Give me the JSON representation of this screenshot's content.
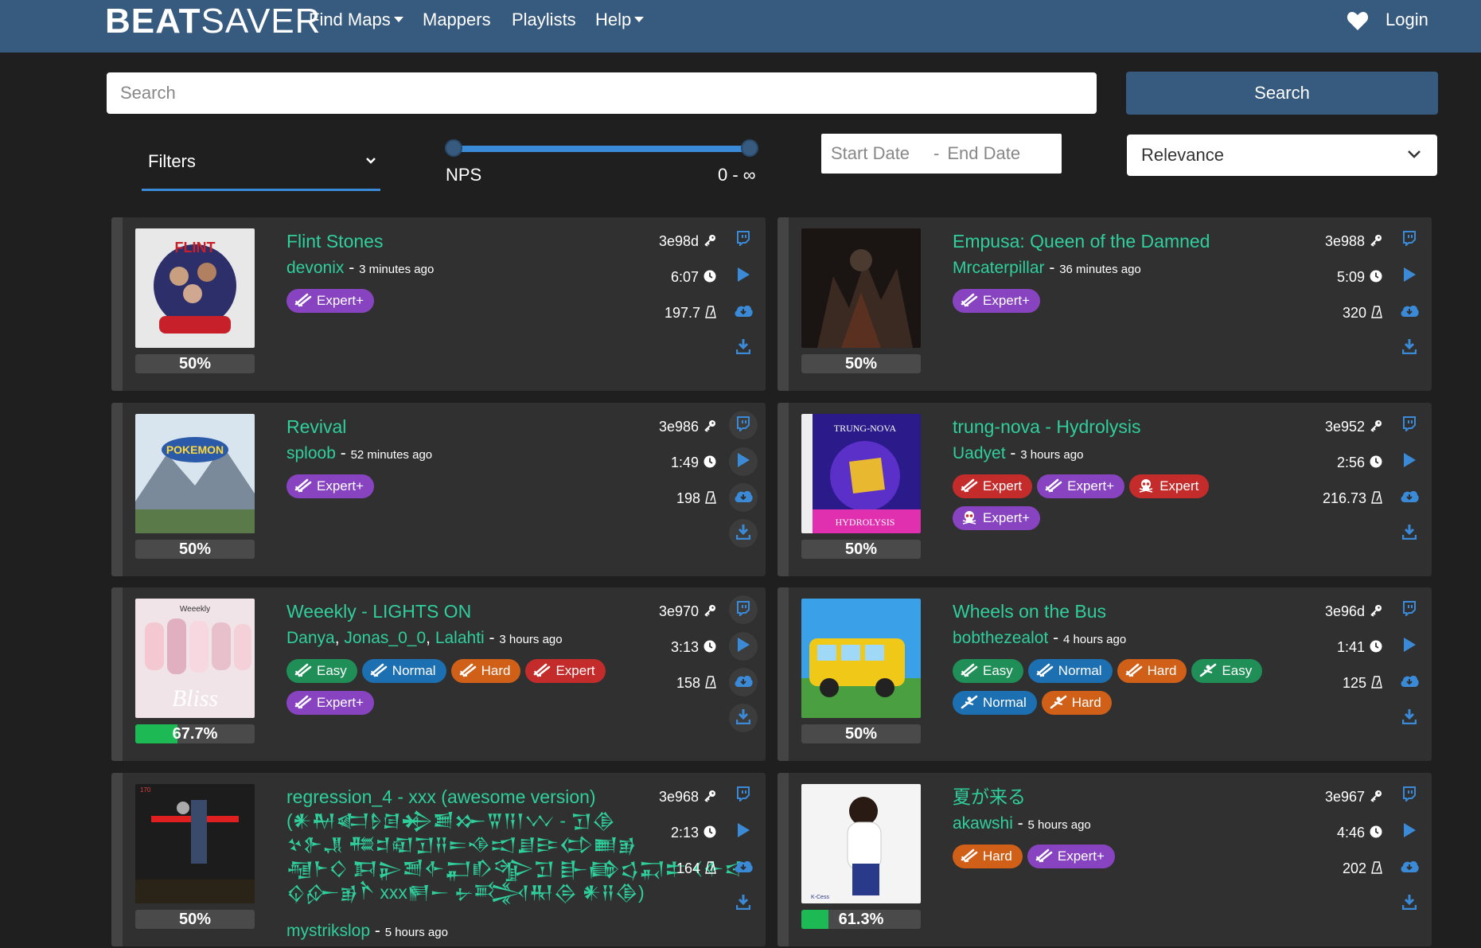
{
  "nav": {
    "brand_bold": "BEAT",
    "brand_light": "SAVER",
    "find_maps": "Find Maps",
    "mappers": "Mappers",
    "playlists": "Playlists",
    "help": "Help",
    "login": "Login"
  },
  "search": {
    "placeholder": "Search",
    "button": "Search"
  },
  "filters": {
    "label": "Filters",
    "nps_label": "NPS",
    "nps_range": "0 - ∞",
    "start_date": "Start Date",
    "date_sep": "-",
    "end_date": "End Date",
    "sort": "Relevance"
  },
  "maps": [
    {
      "title": "Flint Stones",
      "authors": [
        "devonix"
      ],
      "age": "3 minutes ago",
      "key": "3e98d",
      "duration": "6:07",
      "bpm": "197.7",
      "rating": "50%",
      "rating_value": 0.5,
      "diffs": [
        {
          "label": "Expert+",
          "cls": "expertp",
          "icon": "standard"
        }
      ]
    },
    {
      "title": "Empusa: Queen of the Damned",
      "authors": [
        "Mrcaterpillar"
      ],
      "age": "36 minutes ago",
      "key": "3e988",
      "duration": "5:09",
      "bpm": "320",
      "rating": "50%",
      "rating_value": 0.5,
      "diffs": [
        {
          "label": "Expert+",
          "cls": "expertp",
          "icon": "standard"
        }
      ]
    },
    {
      "title": "Revival",
      "authors": [
        "sploob"
      ],
      "age": "52 minutes ago",
      "key": "3e986",
      "duration": "1:49",
      "bpm": "198",
      "rating": "50%",
      "rating_value": 0.5,
      "diffs": [
        {
          "label": "Expert+",
          "cls": "expertp",
          "icon": "standard"
        }
      ]
    },
    {
      "title": "trung-nova - Hydrolysis",
      "authors": [
        "Uadyet"
      ],
      "age": "3 hours ago",
      "key": "3e952",
      "duration": "2:56",
      "bpm": "216.73",
      "rating": "50%",
      "rating_value": 0.5,
      "diffs": [
        {
          "label": "Expert",
          "cls": "expert",
          "icon": "standard"
        },
        {
          "label": "Expert+",
          "cls": "expertp",
          "icon": "standard"
        },
        {
          "label": "Expert",
          "cls": "expert",
          "icon": "skull"
        },
        {
          "label": "Expert+",
          "cls": "expertp",
          "icon": "skull"
        }
      ]
    },
    {
      "title": "Weeekly - LIGHTS ON",
      "authors": [
        "Danya",
        "Jonas_0_0",
        "Lalahti"
      ],
      "age": "3 hours ago",
      "key": "3e970",
      "duration": "3:13",
      "bpm": "158",
      "rating": "67.7%",
      "rating_value": 0.677,
      "diffs": [
        {
          "label": "Easy",
          "cls": "easy",
          "icon": "standard"
        },
        {
          "label": "Normal",
          "cls": "normal",
          "icon": "standard"
        },
        {
          "label": "Hard",
          "cls": "hard",
          "icon": "standard"
        },
        {
          "label": "Expert",
          "cls": "expert",
          "icon": "standard"
        },
        {
          "label": "Expert+",
          "cls": "expertp",
          "icon": "standard"
        }
      ]
    },
    {
      "title": "Wheels on the Bus",
      "authors": [
        "bobthezealot"
      ],
      "age": "4 hours ago",
      "key": "3e96d",
      "duration": "1:41",
      "bpm": "125",
      "rating": "50%",
      "rating_value": 0.5,
      "diffs": [
        {
          "label": "Easy",
          "cls": "easy",
          "icon": "standard"
        },
        {
          "label": "Normal",
          "cls": "normal",
          "icon": "standard"
        },
        {
          "label": "Hard",
          "cls": "hard",
          "icon": "standard"
        },
        {
          "label": "Easy",
          "cls": "easy",
          "icon": "onesaber"
        },
        {
          "label": "Normal",
          "cls": "normal",
          "icon": "onesaber"
        },
        {
          "label": "Hard",
          "cls": "hard",
          "icon": "onesaber"
        }
      ]
    },
    {
      "title": "regression_4 - xxx (awesome version)",
      "title_extra": [
        "(𒀭𒈹𒅗𒊩𒌆𒄈𒋢𒁍𒐊𒀀𒁹𒉼 - 𒋛𒆠",
        "𒆳𒉿𒂗 𒍣𒄑𒊏𒋛𒍝𒋰𒈾𒀊𒋗𒄿𒌌𒆤𒂊",
        "𒆷𒈨𒄭 𒁕𒉌𒍪𒅆𒂷𒁓𒄊𒋛 𒃲𒂵𒌓𒍑𒉺 𒌋𒅆𒁀",
        "𒌒𒅎𒂊𒋻 xxx𒂍𒀸 𒉡𒅋𒊑𒁲 𒀭𒍝𒆠)"
      ],
      "authors": [
        "mystrikslop"
      ],
      "age": "5 hours ago",
      "key": "3e968",
      "duration": "2:13",
      "bpm": "164",
      "rating": "50%",
      "rating_value": 0.5,
      "diffs": []
    },
    {
      "title": "夏が来る",
      "authors": [
        "akawshi"
      ],
      "age": "5 hours ago",
      "key": "3e967",
      "duration": "4:46",
      "bpm": "202",
      "rating": "61.3%",
      "rating_value": 0.613,
      "diffs": [
        {
          "label": "Hard",
          "cls": "hard",
          "icon": "standard"
        },
        {
          "label": "Expert+",
          "cls": "expertp",
          "icon": "standard"
        }
      ]
    }
  ]
}
